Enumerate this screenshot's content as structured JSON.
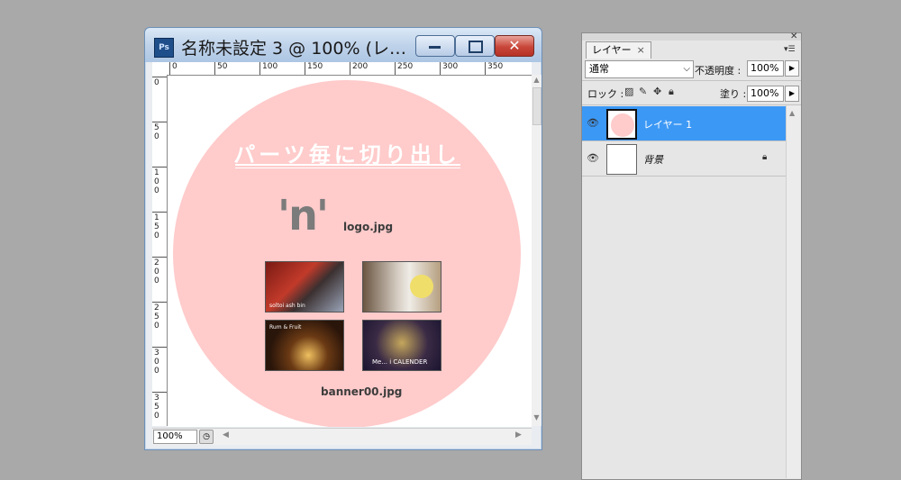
{
  "document": {
    "title": "名称未設定 3 @ 100% (レ…",
    "app_icon": "Ps",
    "ruler_top": [
      "0",
      "50",
      "100",
      "150",
      "200",
      "250",
      "300",
      "350"
    ],
    "ruler_left": [
      "0",
      "50",
      "100",
      "150",
      "200",
      "250",
      "300",
      "350"
    ],
    "zoom": "100%",
    "canvas": {
      "heading": "パーツ毎に切り出し",
      "logo_mark": "'n'",
      "logo_label": "logo.jpg",
      "banner_label": "banner00.jpg",
      "thumbs": [
        {
          "caption": "soltoi ash   bin"
        },
        {
          "caption": ""
        },
        {
          "caption": "Rum & Fruit"
        },
        {
          "caption": "Me...     i CALENDER"
        }
      ],
      "colors": {
        "circle": "#ffcbcb",
        "heading": "#ffffff"
      }
    }
  },
  "layers_panel": {
    "tab": "レイヤー",
    "tab_close": "×",
    "blend_mode": "通常",
    "opacity_label": "不透明度 :",
    "opacity": "100%",
    "lock_label": "ロック :",
    "fill_label": "塗り :",
    "fill": "100%",
    "layers": [
      {
        "name": "レイヤー 1",
        "selected": true
      },
      {
        "name": "背景",
        "selected": false,
        "locked": true
      }
    ],
    "colors": {
      "selected": "#3c98f5"
    }
  }
}
